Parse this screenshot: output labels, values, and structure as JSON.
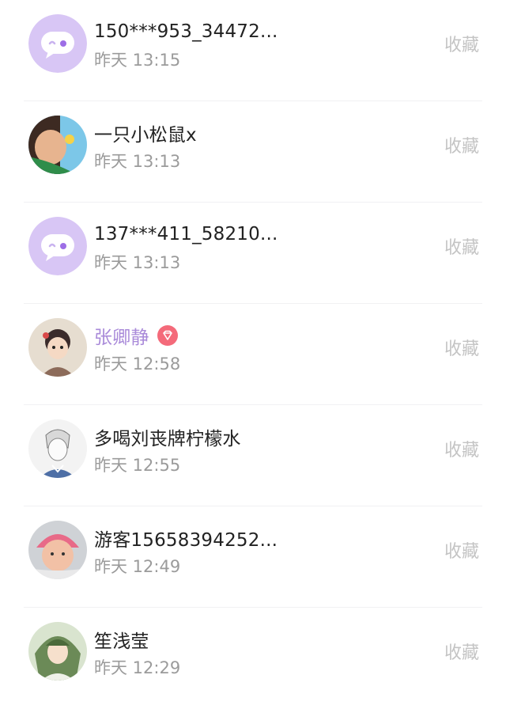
{
  "colors": {
    "default_avatar_bg": "#d8c6f5",
    "default_avatar_fg": "#ffffff",
    "default_avatar_dot": "#9d6ee6",
    "vip_name": "#a98ad9",
    "vip_badge": "#f46a7a",
    "action_text": "#c4c4c4",
    "time_text": "#9b9b9b"
  },
  "rows": [
    {
      "name": "150***953_34472...",
      "time": "昨天 13:15",
      "action": "收藏",
      "avatar": "default-chat-bubble-avatar"
    },
    {
      "name": "一只小松鼠x",
      "time": "昨天 13:13",
      "action": "收藏",
      "avatar": "user-photo-avatar"
    },
    {
      "name": "137***411_58210...",
      "time": "昨天 13:13",
      "action": "收藏",
      "avatar": "default-chat-bubble-avatar"
    },
    {
      "name": "张卿静",
      "time": "昨天 12:58",
      "action": "收藏",
      "avatar": "cartoon-avatar",
      "vip": true,
      "badge_icon": "diamond-icon"
    },
    {
      "name": "多喝刘丧牌柠檬水",
      "time": "昨天 12:55",
      "action": "收藏",
      "avatar": "sketch-avatar"
    },
    {
      "name": "游客15658394252...",
      "time": "昨天 12:49",
      "action": "收藏",
      "avatar": "baby-photo-avatar"
    },
    {
      "name": "笙浅莹",
      "time": "昨天 12:29",
      "action": "收藏",
      "avatar": "illustration-avatar"
    }
  ]
}
